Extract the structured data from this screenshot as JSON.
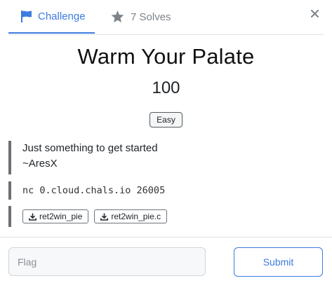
{
  "tabs": {
    "challenge_label": "Challenge",
    "solves_label": "7 Solves",
    "challenge_icon": "flag-icon",
    "solves_icon": "star-icon"
  },
  "close_icon": "close-icon",
  "challenge": {
    "title": "Warm Your Palate",
    "points": "100",
    "difficulty": "Easy",
    "description_line1": "Just something to get started",
    "description_line2": "~AresX",
    "connection": "nc 0.cloud.chals.io 26005",
    "files": [
      {
        "name": "ret2win_pie",
        "icon": "download-icon"
      },
      {
        "name": "ret2win_pie.c",
        "icon": "download-icon"
      }
    ]
  },
  "footer": {
    "flag_placeholder": "Flag",
    "submit_label": "Submit"
  },
  "colors": {
    "accent": "#3d7be0",
    "muted": "#7d8389",
    "block_border": "#6c6f74"
  }
}
